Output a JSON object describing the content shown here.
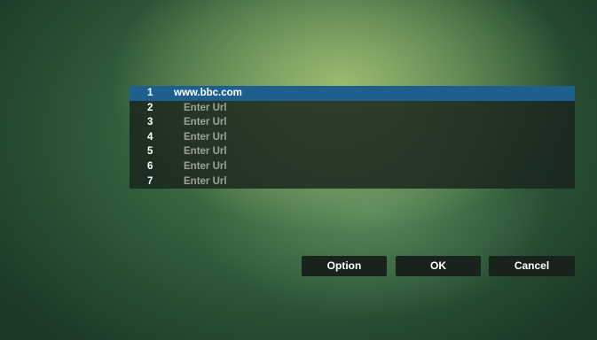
{
  "url_list": {
    "selected_index": 0,
    "items": [
      {
        "number": "1",
        "text": "www.bbc.com"
      },
      {
        "number": "2",
        "text": "Enter Url"
      },
      {
        "number": "3",
        "text": "Enter Url"
      },
      {
        "number": "4",
        "text": "Enter Url"
      },
      {
        "number": "5",
        "text": "Enter Url"
      },
      {
        "number": "6",
        "text": "Enter Url"
      },
      {
        "number": "7",
        "text": "Enter Url"
      }
    ]
  },
  "buttons": {
    "option_label": "Option",
    "ok_label": "OK",
    "cancel_label": "Cancel"
  },
  "colors": {
    "selection": "#1f5f8e",
    "button_bg": "#18231c"
  }
}
